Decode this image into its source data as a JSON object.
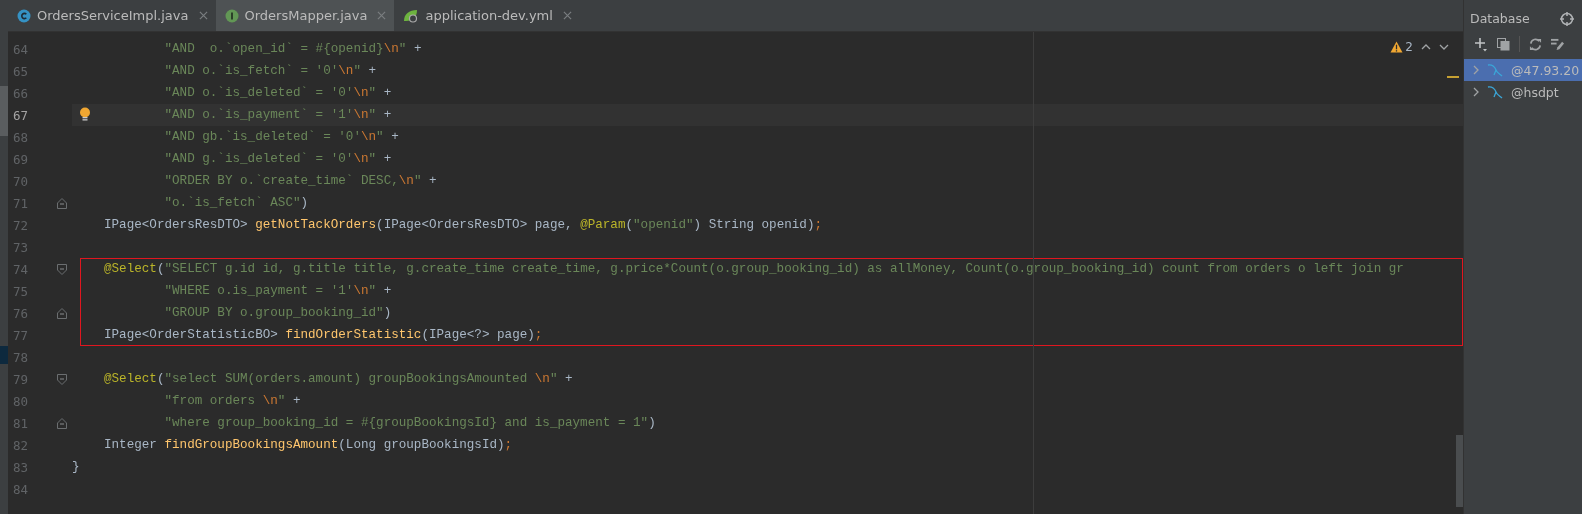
{
  "tabs": [
    {
      "label": "OrdersServiceImpl.java",
      "kind": "class",
      "selected": false
    },
    {
      "label": "OrdersMapper.java",
      "kind": "interface",
      "selected": true
    },
    {
      "label": "application-dev.yml",
      "kind": "yaml",
      "selected": false
    }
  ],
  "inspections": {
    "warnings": "2"
  },
  "blocks": [
    {
      "lines": [
        {
          "number": "64",
          "current": false,
          "tokens": [
            {
              "kind": "s",
              "text": "        \"AND  o.`open_id` = #{openid}"
            },
            {
              "kind": "e",
              "text": "\\n"
            },
            {
              "kind": "s",
              "text": "\""
            },
            {
              "kind": "p",
              "text": " +"
            }
          ]
        },
        {
          "number": "65",
          "current": false,
          "tokens": [
            {
              "kind": "s",
              "text": "        \"AND o.`is_fetch` = '0'"
            },
            {
              "kind": "e",
              "text": "\\n"
            },
            {
              "kind": "s",
              "text": "\""
            },
            {
              "kind": "p",
              "text": " +"
            }
          ]
        },
        {
          "number": "66",
          "current": false,
          "tokens": [
            {
              "kind": "s",
              "text": "        \"AND o.`is_deleted` = '0'"
            },
            {
              "kind": "e",
              "text": "\\n"
            },
            {
              "kind": "s",
              "text": "\""
            },
            {
              "kind": "p",
              "text": " +"
            }
          ]
        },
        {
          "number": "67",
          "current": true,
          "bulb": true,
          "tokens": [
            {
              "kind": "s",
              "text": "        \"AND o.`is_payment` = '1'"
            },
            {
              "kind": "e",
              "text": "\\n"
            },
            {
              "kind": "s",
              "text": "\""
            },
            {
              "kind": "p",
              "text": " +"
            }
          ]
        },
        {
          "number": "68",
          "current": false,
          "tokens": [
            {
              "kind": "s",
              "text": "        \"AND gb.`is_deleted` = '0'"
            },
            {
              "kind": "e",
              "text": "\\n"
            },
            {
              "kind": "s",
              "text": "\""
            },
            {
              "kind": "p",
              "text": " +"
            }
          ]
        },
        {
          "number": "69",
          "current": false,
          "tokens": [
            {
              "kind": "s",
              "text": "        \"AND g.`is_deleted` = '0'"
            },
            {
              "kind": "e",
              "text": "\\n"
            },
            {
              "kind": "s",
              "text": "\""
            },
            {
              "kind": "p",
              "text": " +"
            }
          ]
        },
        {
          "number": "70",
          "current": false,
          "tokens": [
            {
              "kind": "s",
              "text": "        \"ORDER BY o.`create_time` DESC,"
            },
            {
              "kind": "e",
              "text": "\\n"
            },
            {
              "kind": "s",
              "text": "\""
            },
            {
              "kind": "p",
              "text": " +"
            }
          ]
        },
        {
          "number": "71",
          "current": false,
          "fold_end": true,
          "tokens": [
            {
              "kind": "s",
              "text": "        \"o.`is_fetch` ASC\""
            },
            {
              "kind": "p",
              "text": ")"
            }
          ]
        },
        {
          "number": "72",
          "current": false,
          "tokens": [
            {
              "kind": "p",
              "text": "IPage<OrdersResDTO> "
            },
            {
              "kind": "m",
              "text": "getNotTackOrders"
            },
            {
              "kind": "p",
              "text": "(IPage<OrdersResDTO> page, "
            },
            {
              "kind": "a",
              "text": "@Param"
            },
            {
              "kind": "p",
              "text": "("
            },
            {
              "kind": "s",
              "text": "\"openid\""
            },
            {
              "kind": "p",
              "text": ") String openid)"
            },
            {
              "kind": "e",
              "text": ";"
            }
          ]
        },
        {
          "number": "73",
          "current": false
        }
      ]
    },
    {
      "boxed": true,
      "lines": [
        {
          "number": "74",
          "current": false,
          "fold_start": true,
          "tokens": [
            {
              "kind": "a",
              "text": "@Select"
            },
            {
              "kind": "p",
              "text": "("
            },
            {
              "kind": "s",
              "text": "\"SELECT g.id id, g.title title, g.create_time create_time, g.price*Count(o.group_booking_id) as allMoney, Count(o.group_booking_id) count from orders o left join gr"
            }
          ]
        },
        {
          "number": "75",
          "current": false,
          "tokens": [
            {
              "kind": "s",
              "text": "        \"WHERE o.is_payment = '1'"
            },
            {
              "kind": "e",
              "text": "\\n"
            },
            {
              "kind": "s",
              "text": "\""
            },
            {
              "kind": "p",
              "text": " +"
            }
          ]
        },
        {
          "number": "76",
          "current": false,
          "fold_end": true,
          "tokens": [
            {
              "kind": "s",
              "text": "        \"GROUP BY o.group_booking_id\""
            },
            {
              "kind": "p",
              "text": ")"
            }
          ]
        },
        {
          "number": "77",
          "current": false,
          "tokens": [
            {
              "kind": "p",
              "text": "IPage<OrderStatisticBO> "
            },
            {
              "kind": "m",
              "text": "findOrderStatistic"
            },
            {
              "kind": "p",
              "text": "(IPage<?> page)"
            },
            {
              "kind": "e",
              "text": ";"
            }
          ]
        }
      ]
    },
    {
      "lines": [
        {
          "number": "78",
          "current": false
        },
        {
          "number": "79",
          "current": false,
          "fold_start": true,
          "tokens": [
            {
              "kind": "a",
              "text": "@Select"
            },
            {
              "kind": "p",
              "text": "("
            },
            {
              "kind": "s",
              "text": "\"select SUM(orders.amount) groupBookingsAmounted "
            },
            {
              "kind": "e",
              "text": "\\n"
            },
            {
              "kind": "s",
              "text": "\""
            },
            {
              "kind": "p",
              "text": " +"
            }
          ]
        },
        {
          "number": "80",
          "current": false,
          "tokens": [
            {
              "kind": "s",
              "text": "        \"from orders "
            },
            {
              "kind": "e",
              "text": "\\n"
            },
            {
              "kind": "s",
              "text": "\""
            },
            {
              "kind": "p",
              "text": " +"
            }
          ]
        },
        {
          "number": "81",
          "current": false,
          "fold_end": true,
          "tokens": [
            {
              "kind": "s",
              "text": "        \"where group_booking_id = #{groupBookingsId} and is_payment = 1\""
            },
            {
              "kind": "p",
              "text": ")"
            }
          ]
        },
        {
          "number": "82",
          "current": false,
          "tokens": [
            {
              "kind": "p",
              "text": "Integer "
            },
            {
              "kind": "m",
              "text": "findGroupBookingsAmount"
            },
            {
              "kind": "p",
              "text": "(Long groupBookingsId)"
            },
            {
              "kind": "e",
              "text": ";"
            }
          ]
        },
        {
          "number": "83",
          "current": false,
          "outer": true,
          "tokens": [
            {
              "kind": "p",
              "text": "}"
            }
          ]
        },
        {
          "number": "84",
          "current": false
        }
      ]
    }
  ],
  "database": {
    "title": "Database",
    "items": [
      {
        "label": "@47.93.20",
        "selected": true
      },
      {
        "label": "@hsdpt",
        "selected": false
      }
    ]
  }
}
